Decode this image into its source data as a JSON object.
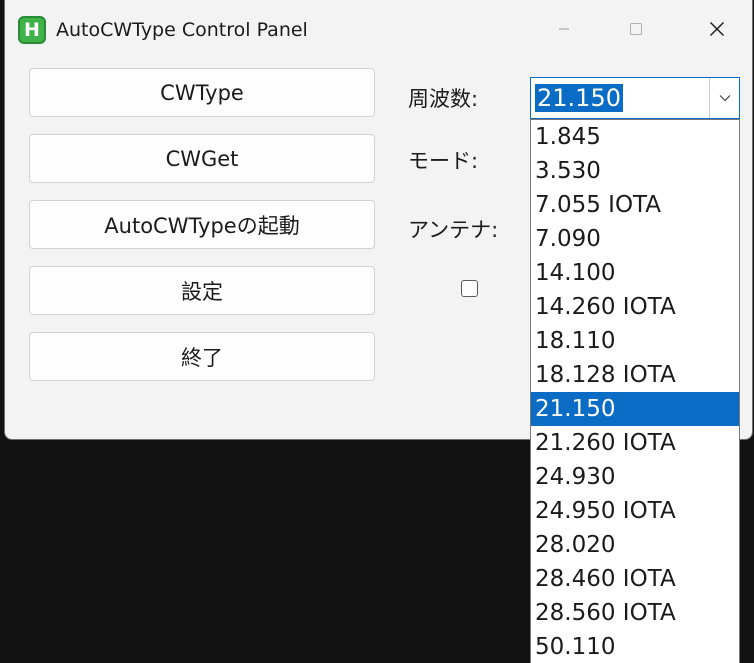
{
  "window": {
    "title": "AutoCWType Control Panel",
    "icon": "H"
  },
  "buttons": [
    "CWType",
    "CWGet",
    "AutoCWTypeの起動",
    "設定",
    "終了"
  ],
  "labels": {
    "frequency": "周波数:",
    "mode": "モード:",
    "antenna": "アンテナ:"
  },
  "frequency": {
    "selected": "21.150",
    "options": [
      "1.845",
      "3.530",
      "7.055 IOTA",
      "7.090",
      "14.100",
      "14.260 IOTA",
      "18.110",
      "18.128 IOTA",
      "21.150",
      "21.260 IOTA",
      "24.930",
      "24.950 IOTA",
      "28.020",
      "28.460 IOTA",
      "28.560 IOTA",
      "50.110"
    ],
    "selected_index": 8
  },
  "colors": {
    "accent": "#0a6cc4",
    "icon_green": "#3fb34a"
  },
  "icons": {
    "minimize": "minimize-icon",
    "maximize": "maximize-icon",
    "close": "close-icon",
    "dropdown": "chevron-down-icon"
  }
}
